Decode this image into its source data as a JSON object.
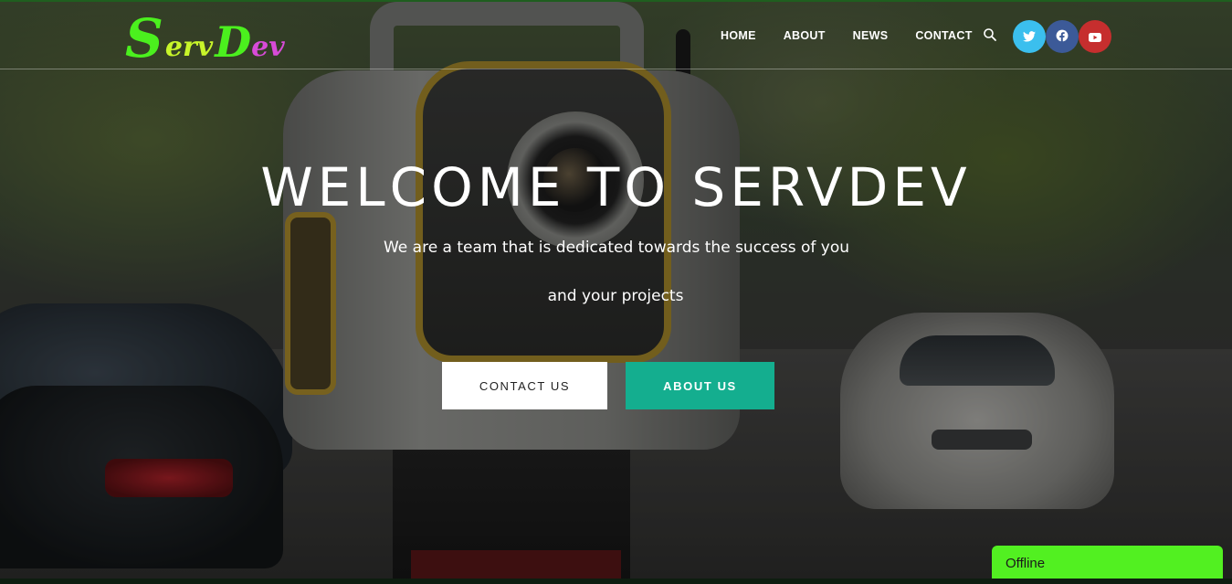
{
  "brand": {
    "logo_parts": [
      "S",
      "erv",
      "D",
      "ev"
    ]
  },
  "nav": {
    "items": [
      "HOME",
      "ABOUT",
      "NEWS",
      "CONTACT"
    ]
  },
  "social": {
    "icons": [
      "twitter-icon",
      "facebook-icon",
      "youtube-icon"
    ],
    "colors": [
      "#3bbfee",
      "#3c5a98",
      "#c62e2e"
    ]
  },
  "hero": {
    "title": "WELCOME TO SERVDEV",
    "subtitle_line1": "We are a team that is dedicated towards the success of you",
    "subtitle_line2": "and your projects",
    "contact_button": "CONTACT US",
    "about_button": "ABOUT US"
  },
  "chat": {
    "status": "Offline"
  },
  "colors": {
    "accent": "#14ae8f",
    "status_offline_bg": "#52f021",
    "logo_green": "#4bf01e",
    "logo_magenta": "#d84bd8"
  }
}
